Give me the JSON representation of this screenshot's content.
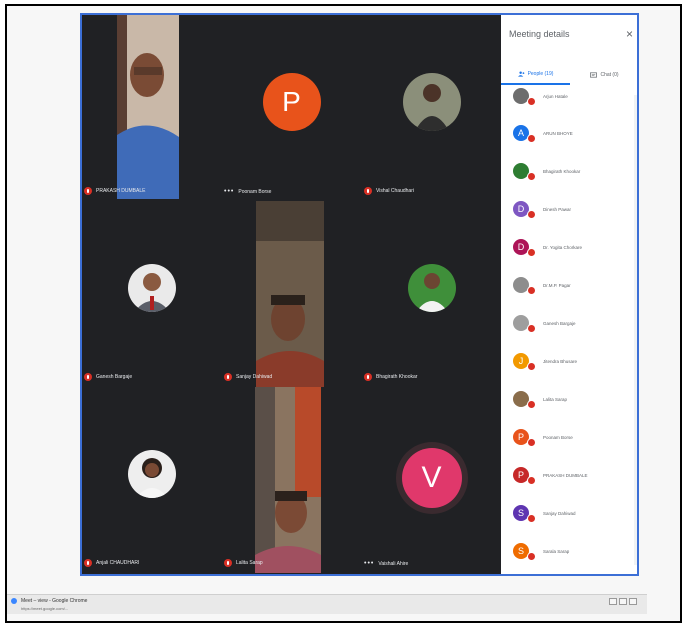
{
  "meeting": {
    "tiles": [
      {
        "name": "PRAKASH DUMBALE",
        "type": "video"
      },
      {
        "name": "Poonam Borse",
        "type": "avatar",
        "letter": "P",
        "color": "#e8531b",
        "dots": "•••"
      },
      {
        "name": "Vishal Chaudhari",
        "type": "photo"
      },
      {
        "name": "Ganesh Bargaje",
        "type": "photo"
      },
      {
        "name": "Sanjay Dahiwad",
        "type": "video"
      },
      {
        "name": "Bhagirath Khookar",
        "type": "photo"
      },
      {
        "name": "Anjali CHAUDHARI",
        "type": "photo"
      },
      {
        "name": "Lalita Sarap",
        "type": "video"
      },
      {
        "name": "Vaishali Ahire",
        "type": "avatar",
        "letter": "V",
        "color": "#e0386b",
        "dots": "•••"
      }
    ]
  },
  "panel": {
    "title": "Meeting details",
    "close_icon": "×",
    "tabs": [
      {
        "label": "People (19)",
        "icon": "people-icon",
        "active": true
      },
      {
        "label": "Chat (0)",
        "icon": "chat-icon",
        "active": false
      }
    ],
    "people": [
      {
        "name": "Arjun Hatale",
        "letter": "",
        "color": "#6d6d6d",
        "photo": true
      },
      {
        "name": "ARUN BHOYE",
        "letter": "A",
        "color": "#1a73e8",
        "photo": false
      },
      {
        "name": "Bhagirath Khookar",
        "letter": "",
        "color": "#2e7d32",
        "photo": true
      },
      {
        "name": "Dinesh Pawar",
        "letter": "D",
        "color": "#7e57c2",
        "photo": false
      },
      {
        "name": "Dr. Yogita Chorkare",
        "letter": "D",
        "color": "#ad1457",
        "photo": false
      },
      {
        "name": "Dr.M.P. Pagar",
        "letter": "",
        "color": "#8d8d8d",
        "photo": true
      },
      {
        "name": "Ganesh Bargaje",
        "letter": "",
        "color": "#9e9e9e",
        "photo": true
      },
      {
        "name": "Jitendra Bhusare",
        "letter": "J",
        "color": "#f29900",
        "photo": false
      },
      {
        "name": "Lalita Sarap",
        "letter": "",
        "color": "#8a6d4b",
        "photo": true
      },
      {
        "name": "Poonam Borse",
        "letter": "P",
        "color": "#e8531b",
        "photo": false
      },
      {
        "name": "PRAKASH DUMBALE",
        "letter": "P",
        "color": "#c62828",
        "photo": false
      },
      {
        "name": "Sanjay Dahiwad",
        "letter": "S",
        "color": "#5e35b1",
        "photo": false
      },
      {
        "name": "Sarala Sarap",
        "letter": "S",
        "color": "#ef6c00",
        "photo": false
      }
    ]
  },
  "taskbar": {
    "title": "Meet – view - Google Chrome",
    "url": "https://meet.google.com/..."
  }
}
